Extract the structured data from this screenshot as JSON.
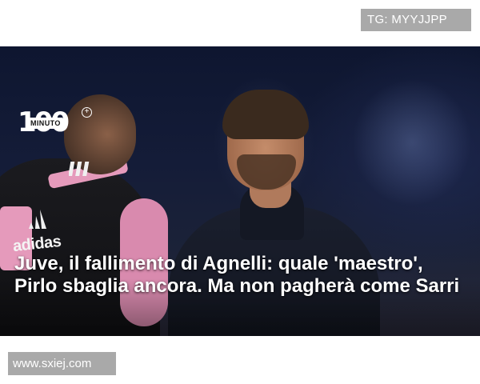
{
  "watermark_top": "TG: MYYJJPP",
  "watermark_bottom": "www.sxiej.com",
  "logo": {
    "number": "100",
    "word": "MINUTO",
    "plus": "+"
  },
  "jersey_brand": "adidas",
  "headline": "Juve, il fallimento di Agnelli: quale 'maestro', Pirlo sbaglia ancora. Ma non pagherà come Sarri",
  "colors": {
    "badge_bg": "#a9a9a9",
    "hero_bg": "#141c38",
    "jersey_pink": "#e59abb",
    "headline_text": "#ffffff"
  }
}
